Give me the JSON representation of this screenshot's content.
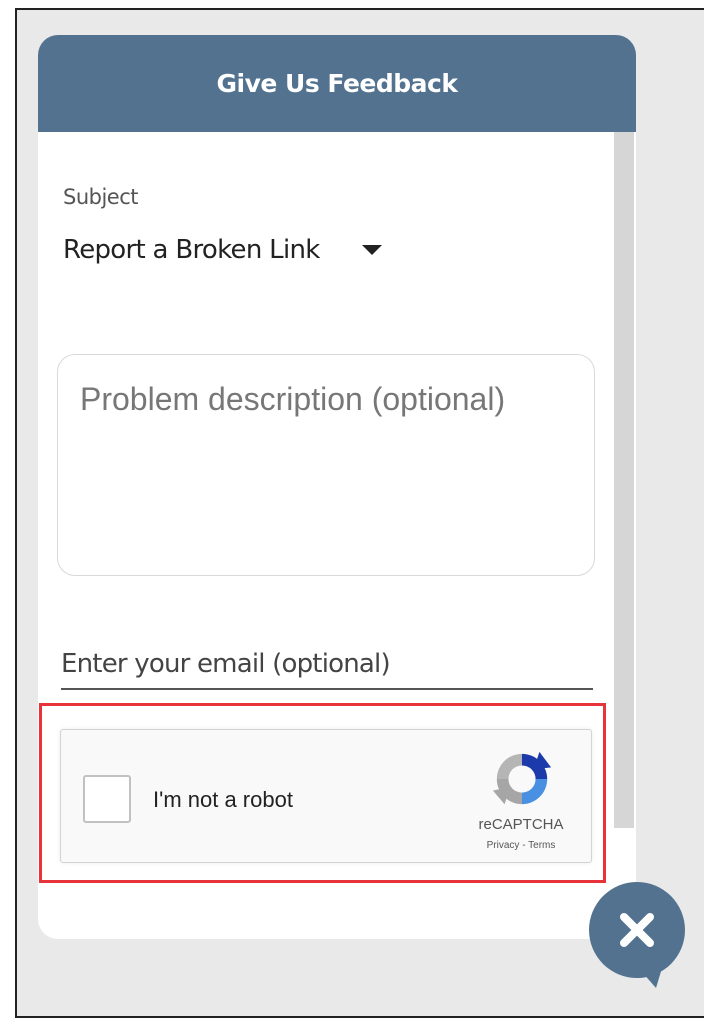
{
  "widget": {
    "title": "Give Us Feedback"
  },
  "form": {
    "subject_label": "Subject",
    "subject_value": "Report a Broken Link",
    "description_placeholder": "Problem description (optional)",
    "email_placeholder": "Enter your email (optional)"
  },
  "recaptcha": {
    "label": "I'm not a robot",
    "brand": "reCAPTCHA",
    "privacy": "Privacy",
    "separator": "-",
    "terms": "Terms",
    "icon": "recaptcha-logo-icon"
  },
  "close_button": {
    "icon": "close-icon",
    "color": "#52728f"
  },
  "colors": {
    "header": "#52728f",
    "highlight": "#e8333a"
  }
}
